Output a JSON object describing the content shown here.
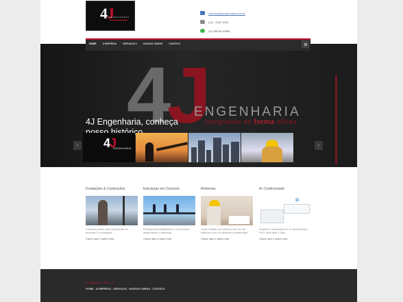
{
  "header": {
    "logo_mark_main": "4",
    "logo_mark_accent": "J",
    "logo_subtitle": "ENGENHARIA",
    "contacts": [
      {
        "icon": "mail-icon",
        "text": "contato@4jengenharia.com.br",
        "link": true
      },
      {
        "icon": "phone-icon",
        "text": "(11) - 2467-3314",
        "link": false
      },
      {
        "icon": "whatsapp-icon",
        "text": "(11) 98230-40986",
        "link": false
      }
    ]
  },
  "nav": {
    "items": [
      "HOME",
      "A EMPRESA",
      "SERVIÇOS ▾",
      "NOSSAS OBRAS",
      "CONTATO"
    ],
    "active_index": 0
  },
  "hero": {
    "title": "4J Engenharia, conheça nosso histórico",
    "subtitle": "4J Engenharia, Integrando de forma eficaz",
    "big_mark_main": "4",
    "big_mark_accent": "J",
    "brand_text": "ENGENHARIA",
    "tagline_before": "Integrando de",
    "tagline_bold": "forma",
    "tagline_after": "eficaz",
    "prev_arrow": "‹",
    "next_arrow": "›",
    "thumb_logo_main": "4",
    "thumb_logo_accent": "J",
    "thumb_logo_sub": "ENGENHARIA"
  },
  "services": [
    {
      "title": "Fundações & Contenções",
      "text": "Uma das partes mais importantes no processo é a fundação.",
      "more": "Clique aqui e saiba mais"
    },
    {
      "title": "Estruturas em Concreto",
      "text": "Profissionais qualificados e no processo ideais fazem a diferença.",
      "more": "Clique aqui e saiba mais"
    },
    {
      "title": "Reformas",
      "text": "Como realizar sua reforma sem dor de cabeça e com os melhores profissionais?",
      "more": "Clique aqui e saiba mais"
    },
    {
      "title": "Ar Condicionado",
      "text": "Projetos e Instalações de ar condicionado VRV, Multi Split e Split.",
      "more": "Clique aqui e saiba mais"
    }
  ],
  "footer": {
    "copyright": "4 Engenharia - 2016 - ®",
    "links": "HOME - A EMPRESA - SERVIÇOS - NOSSAS OBRAS - CONTATO"
  },
  "colors": {
    "accent": "#c8102e",
    "nav_bg": "#2b2b2b",
    "footer_bg": "#2a2a2a"
  }
}
